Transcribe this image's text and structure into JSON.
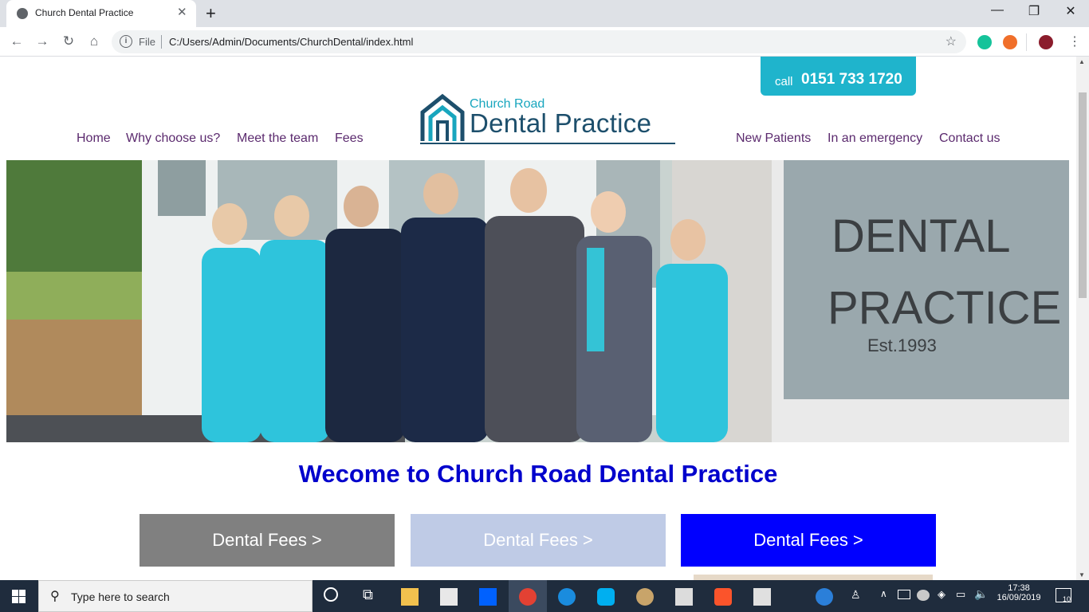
{
  "browser": {
    "tab_title": "Church Dental Practice",
    "omnibox_scheme": "File",
    "url": "C:/Users/Admin/Documents/ChurchDental/index.html"
  },
  "site": {
    "call_label": "call",
    "phone": "0151 733 1720",
    "logo_top": "Church Road",
    "logo_bottom": "Dental Practice",
    "nav_left": [
      "Home",
      "Why choose us?",
      "Meet the team",
      "Fees"
    ],
    "nav_right": [
      "New Patients",
      "In an emergency",
      "Contact us"
    ],
    "welcome": "Wecome to Church Road Dental Practice",
    "fee_buttons": [
      {
        "label": "Dental Fees >",
        "color": "#808080"
      },
      {
        "label": "Dental Fees >",
        "color": "#bfcbe6"
      },
      {
        "label": "Dental Fees >",
        "color": "#0000ff"
      }
    ],
    "hero_sign_line1": "DENTAL",
    "hero_sign_line2": "PRACTICE",
    "hero_sign_line3": "Est.1993"
  },
  "taskbar": {
    "search_placeholder": "Type here to search",
    "time": "17:38",
    "date": "16/09/2019",
    "notification_count": "10"
  },
  "colors": {
    "brand_teal": "#1fb4cc",
    "nav_purple": "#5b2a6e",
    "welcome_blue": "#0000cc"
  }
}
